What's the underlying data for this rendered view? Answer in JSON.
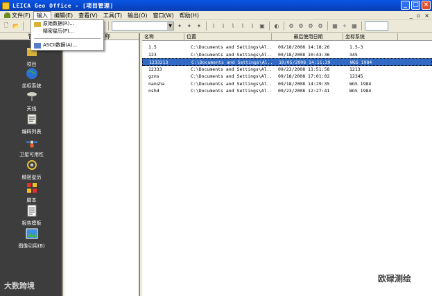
{
  "window": {
    "title": "LEICA Geo Office  - [项目管理]"
  },
  "menubar": {
    "items": [
      "文件(F)",
      "输入",
      "编辑(E)",
      "查看(V)",
      "工具(T)",
      "输出(O)",
      "窗口(W)",
      "帮助(H)"
    ],
    "mdi_controls": [
      "_",
      "▫",
      "×"
    ]
  },
  "dropdown": {
    "items": [
      "原始数据(R)...",
      "精密星历(P)...",
      "ASCII数据(A)..."
    ]
  },
  "sidebar": {
    "header": "管",
    "items": [
      "项目",
      "坐标系统",
      "天线",
      "编码列表",
      "卫星可用性",
      "精密星历",
      "脚本",
      "报告模板",
      "图像引用(B)"
    ]
  },
  "tree": {
    "header": "名称"
  },
  "list": {
    "columns": [
      "名称",
      "位置",
      "最后使用日期",
      "坐标系统"
    ],
    "rows": [
      {
        "name": "1.5",
        "location": "C:\\Documents and Settings\\Al...",
        "date": "09/18/2008 14:18:26",
        "crs": "1.5-3"
      },
      {
        "name": "123",
        "location": "C:\\Documents and Settings\\Al...",
        "date": "09/18/2008 10:43:36",
        "crs": "345"
      },
      {
        "name": "1233213",
        "location": "C:\\Documents and Settings\\Al...",
        "date": "10/05/2008 14:11:39",
        "crs": "WGS 1984"
      },
      {
        "name": "12333",
        "location": "C:\\Documents and Settings\\Al...",
        "date": "09/23/2008 11:51:58",
        "crs": "1213"
      },
      {
        "name": "gzns",
        "location": "C:\\Documents and Settings\\Al...",
        "date": "09/18/2008 17:01:02",
        "crs": "12345"
      },
      {
        "name": "nansha",
        "location": "C:\\Documents and Settings\\Al...",
        "date": "09/18/2008 14:29:35",
        "crs": "WGS 1984"
      },
      {
        "name": "nshd",
        "location": "C:\\Documents and Settings\\Al...",
        "date": "09/23/2008 12:27:41",
        "crs": "WGS 1984"
      }
    ],
    "selected_index": 2
  },
  "watermarks": {
    "left": "大数跨境",
    "right": "欧碌测绘"
  },
  "colors": {
    "titlebar": "#0a55e4",
    "selection": "#316ac5",
    "sidebar": "#3d3d3d"
  }
}
